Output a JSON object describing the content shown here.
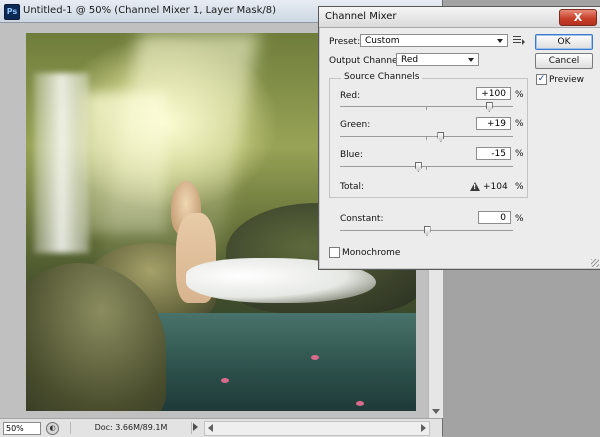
{
  "document": {
    "app_badge": "Ps",
    "title": "Untitled-1 @ 50% (Channel Mixer 1, Layer Mask/8)",
    "zoom": "50%",
    "doc_info": "Doc: 3.66M/89.1M"
  },
  "dialog": {
    "title": "Channel Mixer",
    "close_label": "X",
    "preset_label": "Preset:",
    "preset_value": "Custom",
    "output_channel_label": "Output Channel:",
    "output_channel_value": "Red",
    "ok_label": "OK",
    "cancel_label": "Cancel",
    "preview_label": "Preview",
    "preview_checked": true,
    "source_channels_label": "Source Channels",
    "channels": [
      {
        "label": "Red:",
        "value": "+100",
        "unit": "%",
        "slider_position": 0.86
      },
      {
        "label": "Green:",
        "value": "+19",
        "unit": "%",
        "slider_position": 0.58
      },
      {
        "label": "Blue:",
        "value": "-15",
        "unit": "%",
        "slider_position": 0.45
      }
    ],
    "total_label": "Total:",
    "total_value": "+104",
    "total_unit": "%",
    "constant_label": "Constant:",
    "constant_value": "0",
    "constant_unit": "%",
    "constant_slider_position": 0.5,
    "monochrome_label": "Monochrome",
    "monochrome_checked": false
  },
  "colors": {
    "close_button": "#c7412a",
    "ok_focus": "#3d7bc6",
    "dialog_bg": "#ececec"
  }
}
